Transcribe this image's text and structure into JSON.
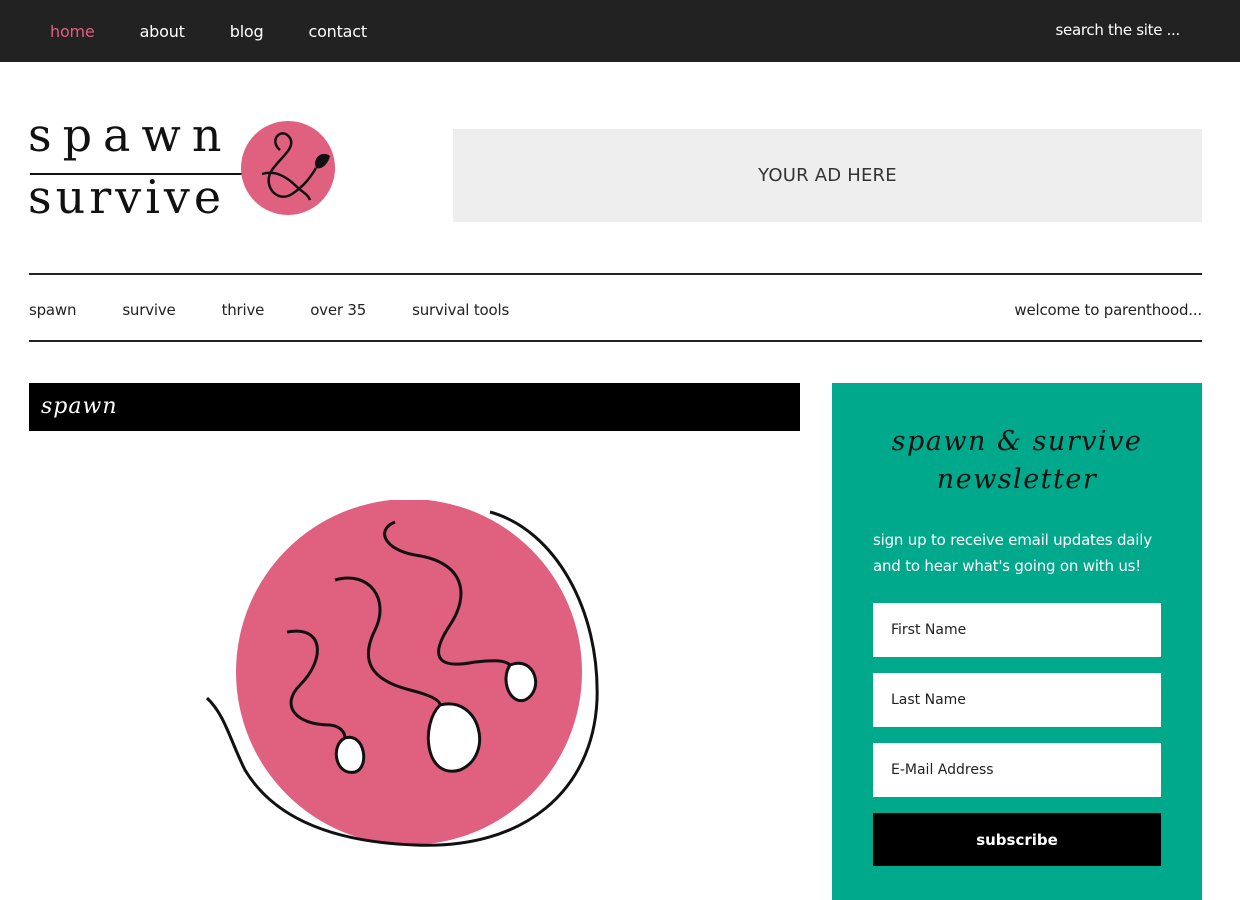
{
  "topnav": {
    "items": [
      {
        "label": "home",
        "active": true
      },
      {
        "label": "about"
      },
      {
        "label": "blog"
      },
      {
        "label": "contact"
      }
    ],
    "search_placeholder": "search the site ..."
  },
  "logo": {
    "line1": "spawn",
    "line2": "survive",
    "accent_color": "#e0607f"
  },
  "ad": {
    "text": "YOUR AD HERE"
  },
  "catnav": {
    "items": [
      "spawn",
      "survive",
      "thrive",
      "over 35",
      "survival tools"
    ],
    "tagline": "welcome to parenthood..."
  },
  "section": {
    "title": "spawn"
  },
  "newsletter": {
    "title_line1": "spawn & survive",
    "title_line2": "newsletter",
    "description": "sign up to receive email updates daily and to hear what's going on with us!",
    "first_name_placeholder": "First Name",
    "last_name_placeholder": "Last Name",
    "email_placeholder": "E-Mail Address",
    "button_label": "subscribe",
    "bg_color": "#00a98c"
  },
  "colors": {
    "topbar": "#222222",
    "active_link": "#e0607f",
    "pink": "#e0607f",
    "teal": "#00a98c"
  }
}
